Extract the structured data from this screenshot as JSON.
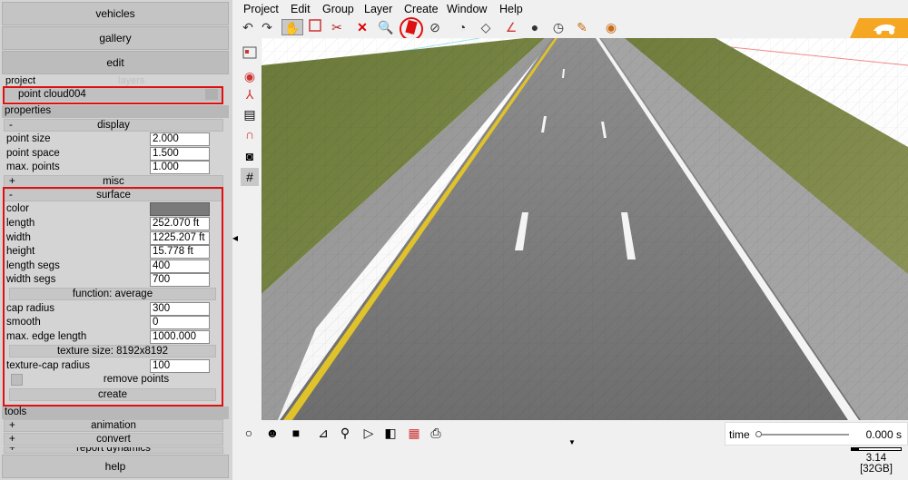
{
  "nav": {
    "vehicles": "vehicles",
    "gallery": "gallery",
    "edit": "edit",
    "help": "help"
  },
  "tabs": {
    "project": "project",
    "layers": "layers"
  },
  "layer_item": "point cloud004",
  "properties": {
    "header": "properties",
    "display": {
      "sign": "-",
      "title": "display",
      "point_size": {
        "label": "point size",
        "value": "2.000"
      },
      "point_space": {
        "label": "point space",
        "value": "1.500"
      },
      "max_points": {
        "label": "max. points",
        "value": "1.000"
      }
    },
    "misc": {
      "sign": "+",
      "title": "misc"
    },
    "surface": {
      "sign": "-",
      "title": "surface",
      "color": {
        "label": "color",
        "swatch": "#7a7a7a"
      },
      "length": {
        "label": "length",
        "value": "252.070 ft"
      },
      "width": {
        "label": "width",
        "value": "1225.207 ft"
      },
      "height": {
        "label": "height",
        "value": "15.778 ft"
      },
      "length_segs": {
        "label": "length segs",
        "value": "400"
      },
      "width_segs": {
        "label": "width segs",
        "value": "700"
      },
      "function": "function: average",
      "cap_radius": {
        "label": "cap radius",
        "value": "300"
      },
      "smooth": {
        "label": "smooth",
        "value": "0"
      },
      "max_edge_length": {
        "label": "max. edge length",
        "value": "1000.000"
      },
      "texture_size": "texture size: 8192x8192",
      "texture_cap_radius": {
        "label": "texture-cap radius",
        "value": "100"
      },
      "remove_points": "remove points",
      "create": "create"
    }
  },
  "tools": {
    "header": "tools",
    "animation": {
      "sign": "+",
      "title": "animation"
    },
    "convert": {
      "sign": "+",
      "title": "convert"
    },
    "report_dynamics": {
      "sign": "+",
      "title": "report dynamics"
    }
  },
  "menu": [
    "Project",
    "Edit",
    "Group",
    "Layer",
    "Create",
    "Window",
    "Help"
  ],
  "timeline": {
    "label": "time",
    "value": "0.000 s"
  },
  "status": {
    "version": "3.14",
    "memory": "[32GB]"
  },
  "colors": {
    "highlight": "#e01010",
    "logo": "#f5a623",
    "panel": "#d4d4d4"
  }
}
